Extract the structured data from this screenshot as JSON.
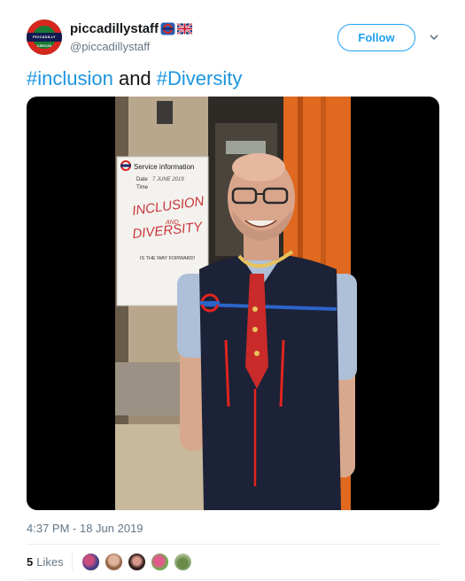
{
  "tweet": {
    "author": {
      "display_name": "piccadillystaff",
      "handle": "@piccadillystaff",
      "avatar_text": "PICCADILLY CIRCUS",
      "badges": [
        "underground-roundel-icon",
        "uk-flag-icon"
      ]
    },
    "follow_label": "Follow",
    "menu_icon": "chevron-down-icon",
    "text": {
      "hashtag1": "#inclusion",
      "conjunction": " and ",
      "hashtag2": "#Diversity"
    },
    "media": {
      "sign_title": "Service information",
      "sign_date_label": "Date",
      "sign_date_value": "7 JUNE 2019",
      "sign_time_label": "Time",
      "sign_line1": "INCLUSION",
      "sign_line2": "AND",
      "sign_line3": "DIVERSITY",
      "sign_line4": "IS THE WAY FORWARD!"
    },
    "timestamp": "4:37 PM - 18 Jun 2019",
    "likes": {
      "count": "5",
      "label": "Likes"
    },
    "likers": [
      "liker-avatar-1",
      "liker-avatar-2",
      "liker-avatar-3",
      "liker-avatar-4",
      "liker-avatar-5"
    ]
  },
  "colors": {
    "link": "#1b95e0",
    "follow": "#1da1f2",
    "muted": "#657786"
  }
}
